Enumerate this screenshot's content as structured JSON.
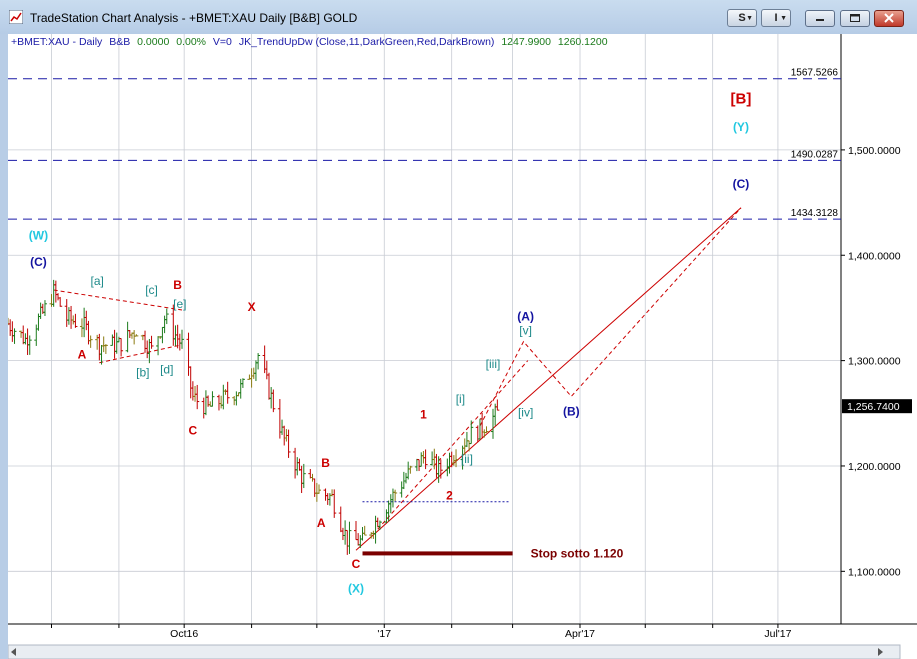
{
  "window": {
    "title": "TradeStation Chart Analysis - +BMET:XAU Daily [B&B] GOLD",
    "btn_s": "S",
    "btn_i": "I"
  },
  "infobar": {
    "symbol": "+BMET:XAU - Daily",
    "session": "B&B",
    "change": "0.0000",
    "pct": "0.00%",
    "volume": "V=0",
    "indicator": "JK_TrendUpDw (Close,11,DarkGreen,Red,DarkBrown)",
    "value1": "1247.9900",
    "value2": "1260.1200"
  },
  "colors": {
    "up_bar": "#1b7a1b",
    "down_bar": "#c00000",
    "neutral_bar": "#8a7a10",
    "dashed_levels": "#1a1aa6",
    "price_marker_bg": "#000000",
    "stop_line": "#7b0000",
    "wave_red": "#cc0000",
    "wave_teal": "#1e8a8a",
    "wave_blue": "#1414a0",
    "wave_cyan": "#22c8e0"
  },
  "chart_data": {
    "type": "ohlc",
    "symbol": "+BMET:XAU",
    "interval": "Daily",
    "ylim": [
      1050,
      1610
    ],
    "y_ticks": [
      "1,100.0000",
      "1,200.0000",
      "1,300.0000",
      "1,400.0000",
      "1,500.0000"
    ],
    "y_tick_values": [
      1100,
      1200,
      1300,
      1400,
      1500
    ],
    "last_price": "1,256.7400",
    "last_price_value": 1256.74,
    "x_ticks": [
      "Oct16",
      "'17",
      "Apr'17",
      "Jul'17"
    ],
    "level_lines": [
      {
        "label": "1567.5266",
        "value": 1567.53
      },
      {
        "label": "1490.0287",
        "value": 1490.03
      },
      {
        "label": "1434.3128",
        "value": 1434.31
      }
    ],
    "close_path": [
      {
        "date": "2016-07-12",
        "close": 1335
      },
      {
        "date": "2016-07-20",
        "close": 1320
      },
      {
        "date": "2016-07-28",
        "close": 1345
      },
      {
        "date": "2016-08-02",
        "close": 1365
      },
      {
        "date": "2016-08-08",
        "close": 1340
      },
      {
        "date": "2016-08-15",
        "close": 1335
      },
      {
        "date": "2016-08-23",
        "close": 1315
      },
      {
        "date": "2016-09-01",
        "close": 1315
      },
      {
        "date": "2016-09-09",
        "close": 1330
      },
      {
        "date": "2016-09-16",
        "close": 1310
      },
      {
        "date": "2016-09-22",
        "close": 1340
      },
      {
        "date": "2016-09-30",
        "close": 1315
      },
      {
        "date": "2016-10-05",
        "close": 1265
      },
      {
        "date": "2016-10-12",
        "close": 1255
      },
      {
        "date": "2016-10-20",
        "close": 1265
      },
      {
        "date": "2016-10-28",
        "close": 1275
      },
      {
        "date": "2016-11-04",
        "close": 1305
      },
      {
        "date": "2016-11-10",
        "close": 1265
      },
      {
        "date": "2016-11-16",
        "close": 1225
      },
      {
        "date": "2016-11-24",
        "close": 1190
      },
      {
        "date": "2016-12-02",
        "close": 1175
      },
      {
        "date": "2016-12-08",
        "close": 1170
      },
      {
        "date": "2016-12-15",
        "close": 1130
      },
      {
        "date": "2016-12-22",
        "close": 1128
      },
      {
        "date": "2016-12-29",
        "close": 1150
      },
      {
        "date": "2017-01-06",
        "close": 1175
      },
      {
        "date": "2017-01-13",
        "close": 1195
      },
      {
        "date": "2017-01-20",
        "close": 1210
      },
      {
        "date": "2017-01-26",
        "close": 1195
      },
      {
        "date": "2017-02-03",
        "close": 1215
      },
      {
        "date": "2017-02-10",
        "close": 1230
      },
      {
        "date": "2017-02-17",
        "close": 1240
      },
      {
        "date": "2017-02-22",
        "close": 1250
      }
    ],
    "projections": [
      {
        "name": "trend-line",
        "style": "solid",
        "points": [
          {
            "date": "2016-12-19",
            "value": 1120
          },
          {
            "date": "2017-06-14",
            "value": 1445
          }
        ]
      },
      {
        "name": "channel-line",
        "style": "dashed",
        "points": [
          {
            "date": "2016-12-29",
            "value": 1140
          },
          {
            "date": "2017-03-08",
            "value": 1300
          }
        ]
      },
      {
        "name": "projected-path",
        "style": "dashed",
        "points": [
          {
            "date": "2017-02-14",
            "value": 1238
          },
          {
            "date": "2017-03-06",
            "value": 1318
          },
          {
            "date": "2017-03-28",
            "value": 1266
          },
          {
            "date": "2017-06-14",
            "value": 1445
          }
        ]
      },
      {
        "name": "triangle-upper",
        "style": "dashed",
        "points": [
          {
            "date": "2016-08-02",
            "value": 1367
          },
          {
            "date": "2016-09-30",
            "value": 1348
          }
        ]
      },
      {
        "name": "triangle-lower",
        "style": "dashed",
        "points": [
          {
            "date": "2016-08-23",
            "value": 1298
          },
          {
            "date": "2016-09-30",
            "value": 1315
          }
        ]
      },
      {
        "name": "support-line",
        "style": "dotted",
        "points": [
          {
            "date": "2016-12-22",
            "value": 1166
          },
          {
            "date": "2017-02-28",
            "value": 1166
          }
        ]
      }
    ],
    "stop": {
      "label": "Stop sotto 1.120",
      "value": 1117,
      "from": "2016-12-22",
      "to": "2017-03-01"
    },
    "annotations": [
      {
        "text": "(W)",
        "color": "wave_cyan",
        "date": "2016-07-26",
        "value": 1415
      },
      {
        "text": "(C)",
        "color": "wave_blue",
        "date": "2016-07-26",
        "value": 1390
      },
      {
        "text": "A",
        "color": "wave_red",
        "date": "2016-08-15",
        "value": 1302
      },
      {
        "text": "[a]",
        "color": "wave_teal",
        "date": "2016-08-22",
        "value": 1372
      },
      {
        "text": "[b]",
        "color": "wave_teal",
        "date": "2016-09-12",
        "value": 1285
      },
      {
        "text": "[c]",
        "color": "wave_teal",
        "date": "2016-09-16",
        "value": 1363
      },
      {
        "text": "[d]",
        "color": "wave_teal",
        "date": "2016-09-23",
        "value": 1288
      },
      {
        "text": "[e]",
        "color": "wave_teal",
        "date": "2016-09-29",
        "value": 1350
      },
      {
        "text": "B",
        "color": "wave_red",
        "date": "2016-09-28",
        "value": 1368
      },
      {
        "text": "C",
        "color": "wave_red",
        "date": "2016-10-05",
        "value": 1230
      },
      {
        "text": "X",
        "color": "wave_red",
        "date": "2016-11-01",
        "value": 1347
      },
      {
        "text": "B",
        "color": "wave_red",
        "date": "2016-12-05",
        "value": 1199
      },
      {
        "text": "A",
        "color": "wave_red",
        "date": "2016-12-03",
        "value": 1142
      },
      {
        "text": "C",
        "color": "wave_red",
        "date": "2016-12-19",
        "value": 1103
      },
      {
        "text": "(X)",
        "color": "wave_cyan",
        "date": "2016-12-19",
        "value": 1080
      },
      {
        "text": "1",
        "color": "wave_red",
        "date": "2017-01-19",
        "value": 1245
      },
      {
        "text": "2",
        "color": "wave_red",
        "date": "2017-01-31",
        "value": 1168
      },
      {
        "text": "[i]",
        "color": "wave_teal",
        "date": "2017-02-05",
        "value": 1260
      },
      {
        "text": "[ii]",
        "color": "wave_teal",
        "date": "2017-02-08",
        "value": 1203
      },
      {
        "text": "[iii]",
        "color": "wave_teal",
        "date": "2017-02-20",
        "value": 1293
      },
      {
        "text": "[iv]",
        "color": "wave_teal",
        "date": "2017-03-07",
        "value": 1247
      },
      {
        "text": "[v]",
        "color": "wave_teal",
        "date": "2017-03-07",
        "value": 1325
      },
      {
        "text": "(A)",
        "color": "wave_blue",
        "date": "2017-03-07",
        "value": 1338
      },
      {
        "text": "(B)",
        "color": "wave_blue",
        "date": "2017-03-28",
        "value": 1248
      },
      {
        "text": "(C)",
        "color": "wave_blue",
        "date": "2017-06-14",
        "value": 1464
      },
      {
        "text": "(Y)",
        "color": "wave_cyan",
        "date": "2017-06-14",
        "value": 1518
      },
      {
        "text": "[B]",
        "color": "wave_red",
        "date": "2017-06-14",
        "value": 1544
      }
    ]
  }
}
